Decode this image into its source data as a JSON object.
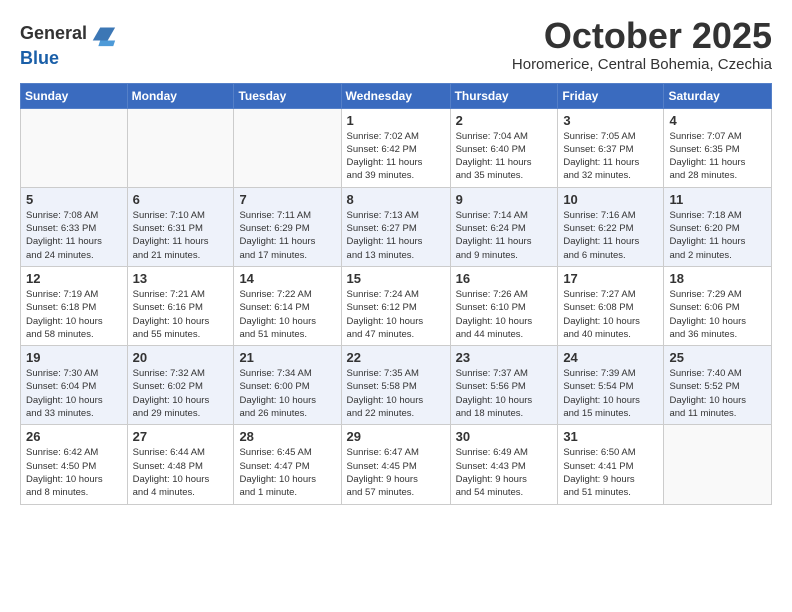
{
  "header": {
    "logo_line1": "General",
    "logo_line2": "Blue",
    "month": "October 2025",
    "location": "Horomerice, Central Bohemia, Czechia"
  },
  "weekdays": [
    "Sunday",
    "Monday",
    "Tuesday",
    "Wednesday",
    "Thursday",
    "Friday",
    "Saturday"
  ],
  "weeks": [
    [
      {
        "day": "",
        "info": ""
      },
      {
        "day": "",
        "info": ""
      },
      {
        "day": "",
        "info": ""
      },
      {
        "day": "1",
        "info": "Sunrise: 7:02 AM\nSunset: 6:42 PM\nDaylight: 11 hours\nand 39 minutes."
      },
      {
        "day": "2",
        "info": "Sunrise: 7:04 AM\nSunset: 6:40 PM\nDaylight: 11 hours\nand 35 minutes."
      },
      {
        "day": "3",
        "info": "Sunrise: 7:05 AM\nSunset: 6:37 PM\nDaylight: 11 hours\nand 32 minutes."
      },
      {
        "day": "4",
        "info": "Sunrise: 7:07 AM\nSunset: 6:35 PM\nDaylight: 11 hours\nand 28 minutes."
      }
    ],
    [
      {
        "day": "5",
        "info": "Sunrise: 7:08 AM\nSunset: 6:33 PM\nDaylight: 11 hours\nand 24 minutes."
      },
      {
        "day": "6",
        "info": "Sunrise: 7:10 AM\nSunset: 6:31 PM\nDaylight: 11 hours\nand 21 minutes."
      },
      {
        "day": "7",
        "info": "Sunrise: 7:11 AM\nSunset: 6:29 PM\nDaylight: 11 hours\nand 17 minutes."
      },
      {
        "day": "8",
        "info": "Sunrise: 7:13 AM\nSunset: 6:27 PM\nDaylight: 11 hours\nand 13 minutes."
      },
      {
        "day": "9",
        "info": "Sunrise: 7:14 AM\nSunset: 6:24 PM\nDaylight: 11 hours\nand 9 minutes."
      },
      {
        "day": "10",
        "info": "Sunrise: 7:16 AM\nSunset: 6:22 PM\nDaylight: 11 hours\nand 6 minutes."
      },
      {
        "day": "11",
        "info": "Sunrise: 7:18 AM\nSunset: 6:20 PM\nDaylight: 11 hours\nand 2 minutes."
      }
    ],
    [
      {
        "day": "12",
        "info": "Sunrise: 7:19 AM\nSunset: 6:18 PM\nDaylight: 10 hours\nand 58 minutes."
      },
      {
        "day": "13",
        "info": "Sunrise: 7:21 AM\nSunset: 6:16 PM\nDaylight: 10 hours\nand 55 minutes."
      },
      {
        "day": "14",
        "info": "Sunrise: 7:22 AM\nSunset: 6:14 PM\nDaylight: 10 hours\nand 51 minutes."
      },
      {
        "day": "15",
        "info": "Sunrise: 7:24 AM\nSunset: 6:12 PM\nDaylight: 10 hours\nand 47 minutes."
      },
      {
        "day": "16",
        "info": "Sunrise: 7:26 AM\nSunset: 6:10 PM\nDaylight: 10 hours\nand 44 minutes."
      },
      {
        "day": "17",
        "info": "Sunrise: 7:27 AM\nSunset: 6:08 PM\nDaylight: 10 hours\nand 40 minutes."
      },
      {
        "day": "18",
        "info": "Sunrise: 7:29 AM\nSunset: 6:06 PM\nDaylight: 10 hours\nand 36 minutes."
      }
    ],
    [
      {
        "day": "19",
        "info": "Sunrise: 7:30 AM\nSunset: 6:04 PM\nDaylight: 10 hours\nand 33 minutes."
      },
      {
        "day": "20",
        "info": "Sunrise: 7:32 AM\nSunset: 6:02 PM\nDaylight: 10 hours\nand 29 minutes."
      },
      {
        "day": "21",
        "info": "Sunrise: 7:34 AM\nSunset: 6:00 PM\nDaylight: 10 hours\nand 26 minutes."
      },
      {
        "day": "22",
        "info": "Sunrise: 7:35 AM\nSunset: 5:58 PM\nDaylight: 10 hours\nand 22 minutes."
      },
      {
        "day": "23",
        "info": "Sunrise: 7:37 AM\nSunset: 5:56 PM\nDaylight: 10 hours\nand 18 minutes."
      },
      {
        "day": "24",
        "info": "Sunrise: 7:39 AM\nSunset: 5:54 PM\nDaylight: 10 hours\nand 15 minutes."
      },
      {
        "day": "25",
        "info": "Sunrise: 7:40 AM\nSunset: 5:52 PM\nDaylight: 10 hours\nand 11 minutes."
      }
    ],
    [
      {
        "day": "26",
        "info": "Sunrise: 6:42 AM\nSunset: 4:50 PM\nDaylight: 10 hours\nand 8 minutes."
      },
      {
        "day": "27",
        "info": "Sunrise: 6:44 AM\nSunset: 4:48 PM\nDaylight: 10 hours\nand 4 minutes."
      },
      {
        "day": "28",
        "info": "Sunrise: 6:45 AM\nSunset: 4:47 PM\nDaylight: 10 hours\nand 1 minute."
      },
      {
        "day": "29",
        "info": "Sunrise: 6:47 AM\nSunset: 4:45 PM\nDaylight: 9 hours\nand 57 minutes."
      },
      {
        "day": "30",
        "info": "Sunrise: 6:49 AM\nSunset: 4:43 PM\nDaylight: 9 hours\nand 54 minutes."
      },
      {
        "day": "31",
        "info": "Sunrise: 6:50 AM\nSunset: 4:41 PM\nDaylight: 9 hours\nand 51 minutes."
      },
      {
        "day": "",
        "info": ""
      }
    ]
  ]
}
